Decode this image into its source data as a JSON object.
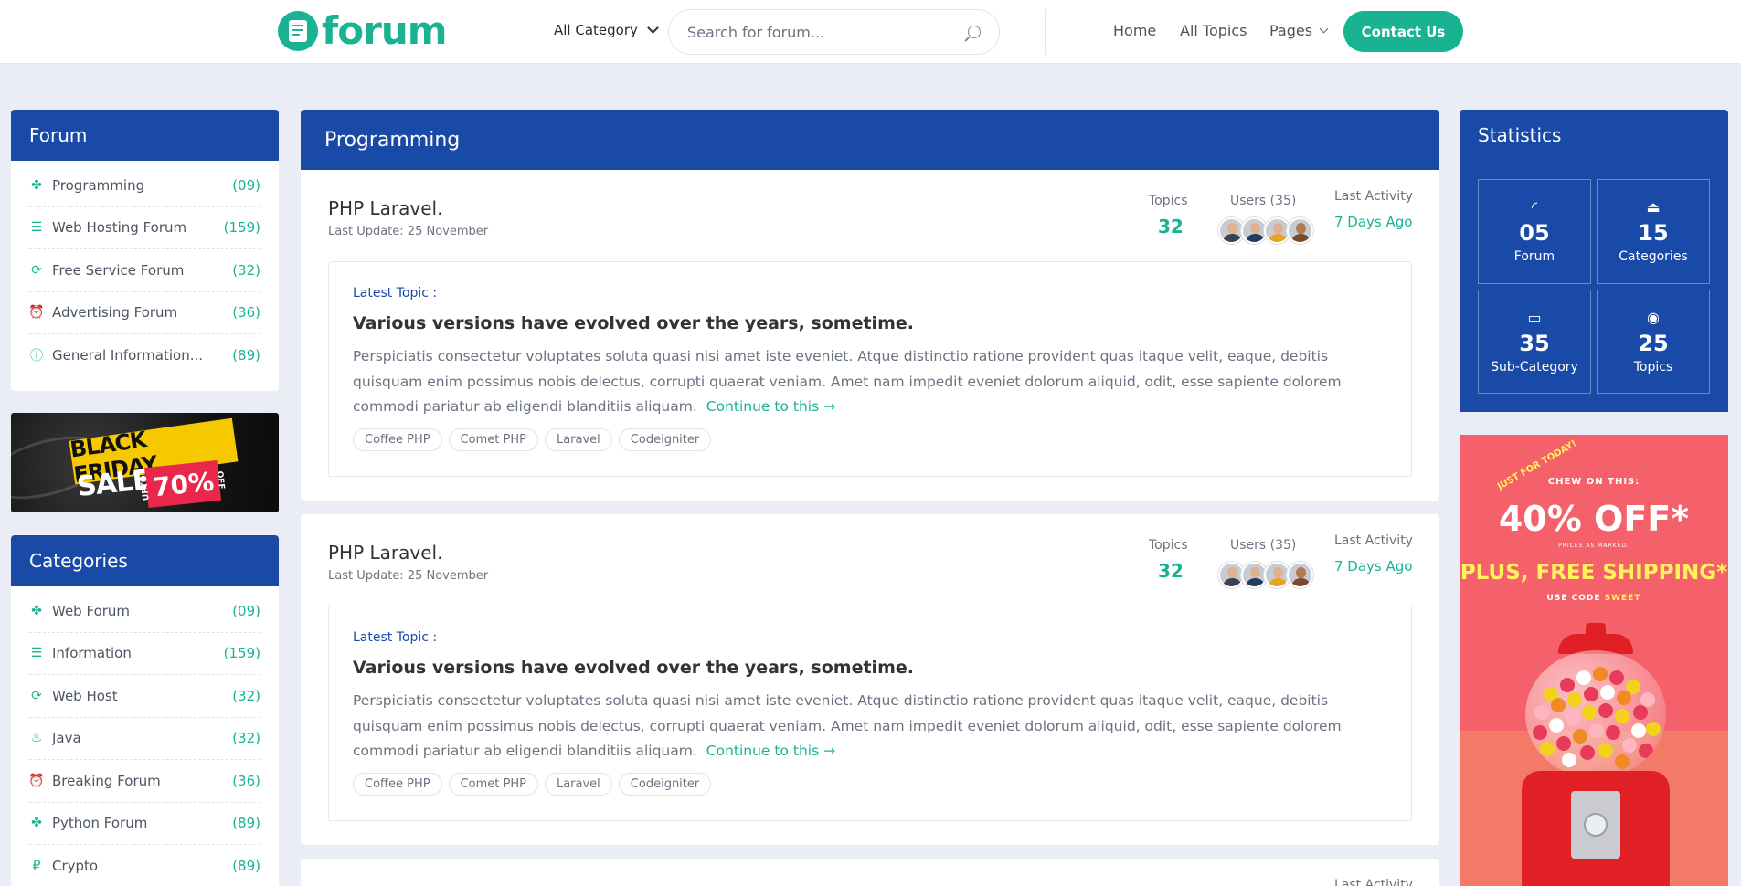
{
  "header": {
    "logo_text": "forum",
    "category_select": "All Category",
    "search_placeholder": "Search for forum...",
    "nav": [
      "Home",
      "All Topics",
      "Pages"
    ],
    "contact_button": "Contact Us"
  },
  "forum_panel": {
    "title": "Forum",
    "items": [
      {
        "icon": "puzzle-icon",
        "label": "Programming",
        "count": "(09)"
      },
      {
        "icon": "server-icon",
        "label": "Web Hosting Forum",
        "count": "(159)"
      },
      {
        "icon": "refresh-icon",
        "label": "Free Service Forum",
        "count": "(32)"
      },
      {
        "icon": "alarm-clock-icon",
        "label": "Advertising Forum",
        "count": "(36)"
      },
      {
        "icon": "info-icon",
        "label": "General Information...",
        "count": "(89)"
      }
    ]
  },
  "banner_black_friday": {
    "line1": "BLACK FRIDAY",
    "line2": "SALE",
    "upto": "UPTO",
    "percent": "70%",
    "off": "OFF"
  },
  "categories_panel": {
    "title": "Categories",
    "items": [
      {
        "icon": "puzzle-icon",
        "label": "Web Forum",
        "count": "(09)"
      },
      {
        "icon": "server-icon",
        "label": "Information",
        "count": "(159)"
      },
      {
        "icon": "refresh-icon",
        "label": "Web Host",
        "count": "(32)"
      },
      {
        "icon": "java-icon",
        "label": "Java",
        "count": "(32)"
      },
      {
        "icon": "alarm-clock-icon",
        "label": "Breaking Forum",
        "count": "(36)"
      },
      {
        "icon": "puzzle-icon",
        "label": "Python Forum",
        "count": "(89)"
      },
      {
        "icon": "ruble-icon",
        "label": "Crypto",
        "count": "(89)"
      }
    ]
  },
  "main": {
    "heading": "Programming",
    "cards": [
      {
        "title": "PHP Laravel.",
        "last_update": "Last Update: 25 November",
        "topics_label": "Topics",
        "topics_value": "32",
        "users_label": "Users (35)",
        "last_activity_label": "Last Activity",
        "last_activity_value": "7 Days Ago",
        "latest_label": "Latest Topic :",
        "topic_title": "Various versions have evolved over the years, sometime.",
        "topic_text": "Perspiciatis consectetur voluptates soluta quasi nisi amet iste eveniet. Atque distinctio ratione provident quas itaque velit, eaque, debitis quisquam enim possimus nobis delectus, corrupti quaerat veniam. Amet nam impedit eveniet dolorum aliquid, odit, esse sapiente dolorem commodi pariatur ab eligendi blanditiis aliquam.",
        "continue_label": "Continue to this →",
        "tags": [
          "Coffee PHP",
          "Comet PHP",
          "Laravel",
          "Codeigniter"
        ]
      },
      {
        "title": "PHP Laravel.",
        "last_update": "Last Update: 25 November",
        "topics_label": "Topics",
        "topics_value": "32",
        "users_label": "Users (35)",
        "last_activity_label": "Last Activity",
        "last_activity_value": "7 Days Ago",
        "latest_label": "Latest Topic :",
        "topic_title": "Various versions have evolved over the years, sometime.",
        "topic_text": "Perspiciatis consectetur voluptates soluta quasi nisi amet iste eveniet. Atque distinctio ratione provident quas itaque velit, eaque, debitis quisquam enim possimus nobis delectus, corrupti quaerat veniam. Amet nam impedit eveniet dolorum aliquid, odit, esse sapiente dolorem commodi pariatur ab eligendi blanditiis aliquam.",
        "continue_label": "Continue to this →",
        "tags": [
          "Coffee PHP",
          "Comet PHP",
          "Laravel",
          "Codeigniter"
        ]
      },
      {
        "last_activity_label": "Last Activity"
      }
    ]
  },
  "statistics": {
    "title": "Statistics",
    "cells": [
      {
        "icon": "signal-icon",
        "value": "05",
        "label": "Forum"
      },
      {
        "icon": "stamp-icon",
        "value": "15",
        "label": "Categories"
      },
      {
        "icon": "card-icon",
        "value": "35",
        "label": "Sub-Category"
      },
      {
        "icon": "stop-circle-icon",
        "value": "25",
        "label": "Topics"
      }
    ]
  },
  "promo": {
    "sticker": "JUST FOR TODAY!",
    "chew": "CHEW ON THIS:",
    "big": "40% OFF*",
    "small": "PRICES AS MARKED.",
    "ship": "PLUS, FREE SHIPPING*",
    "code_prefix": "USE CODE",
    "code": "SWEET"
  },
  "colors": {
    "brand_green": "#19b394",
    "brand_blue": "#1a4aa8",
    "background": "#eaedf5"
  }
}
